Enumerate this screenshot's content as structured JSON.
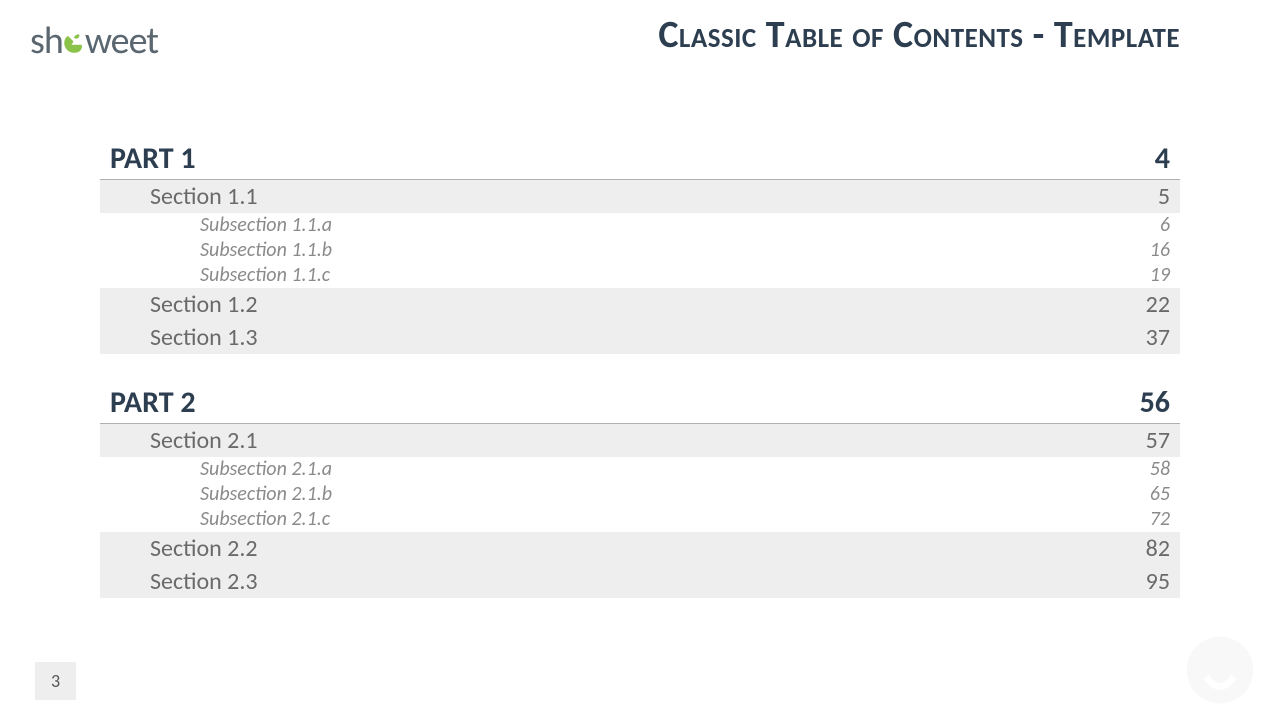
{
  "brand": {
    "left": "sh",
    "right": "weet"
  },
  "title": "Classic Table of Contents - Template",
  "slide_number": "3",
  "toc": [
    {
      "label": "PART 1",
      "page": "4",
      "sections": [
        {
          "label": "Section 1.1",
          "page": "5",
          "subsections": [
            {
              "label": "Subsection 1.1.a",
              "page": "6"
            },
            {
              "label": "Subsection 1.1.b",
              "page": "16"
            },
            {
              "label": "Subsection 1.1.c",
              "page": "19"
            }
          ]
        },
        {
          "label": "Section 1.2",
          "page": "22",
          "subsections": []
        },
        {
          "label": "Section 1.3",
          "page": "37",
          "subsections": []
        }
      ]
    },
    {
      "label": "PART 2",
      "page": "56",
      "sections": [
        {
          "label": "Section 2.1",
          "page": "57",
          "subsections": [
            {
              "label": "Subsection 2.1.a",
              "page": "58"
            },
            {
              "label": "Subsection 2.1.b",
              "page": "65"
            },
            {
              "label": "Subsection 2.1.c",
              "page": "72"
            }
          ]
        },
        {
          "label": "Section 2.2",
          "page": "82",
          "subsections": []
        },
        {
          "label": "Section 2.3",
          "page": "95",
          "subsections": []
        }
      ]
    }
  ]
}
